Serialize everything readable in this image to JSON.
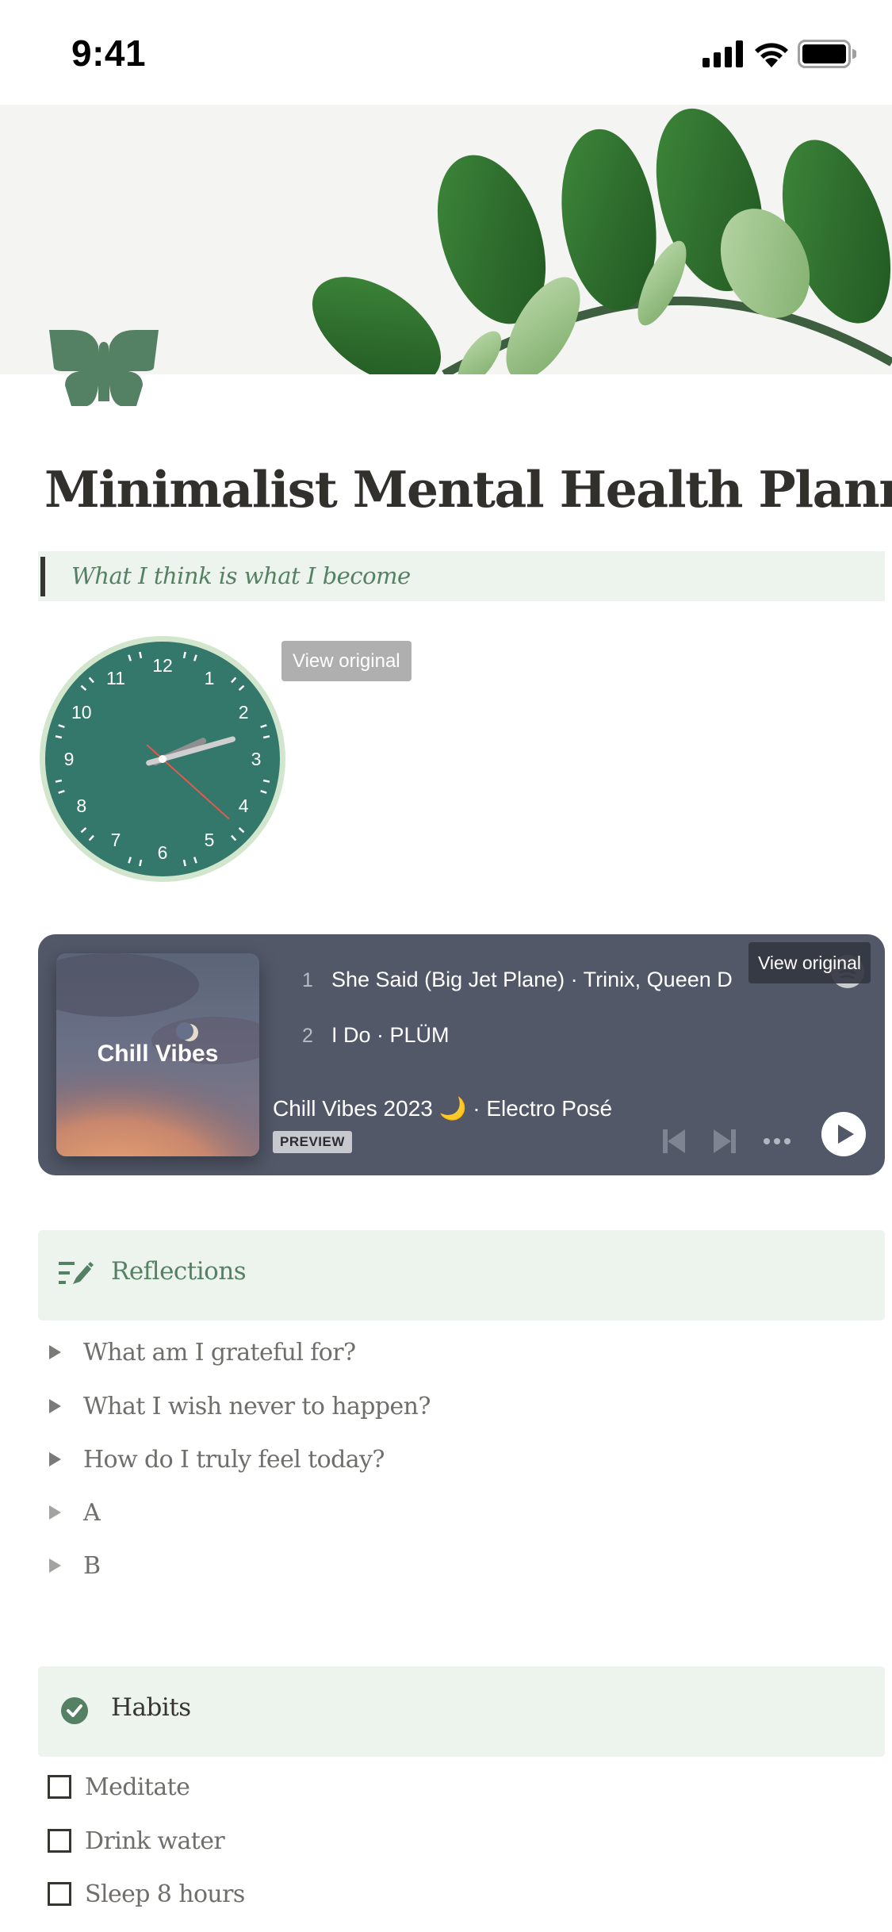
{
  "status_bar": {
    "time": "9:41"
  },
  "page": {
    "title": "Minimalist Mental Health Planner",
    "quote": "What I think is what I become",
    "accent_color": "#548164",
    "callout_bg": "#edf3ed"
  },
  "clock_widget": {
    "view_original_label": "View original",
    "numbers": [
      "12",
      "1",
      "2",
      "3",
      "4",
      "5",
      "6",
      "7",
      "8",
      "9",
      "10",
      "11"
    ],
    "time_shown": {
      "hours": 2,
      "minutes": 12,
      "seconds": 22
    }
  },
  "spotify_embed": {
    "view_original_label": "View original",
    "album_title": "Chill Vibes",
    "tracks": [
      {
        "number": "1",
        "title": "She Said (Big Jet Plane) · Trinix, Queen D"
      },
      {
        "number": "2",
        "title": "I Do · PLÜM"
      }
    ],
    "playlist": "Chill Vibes 2023 🌙 · Electro Posé",
    "badge": "PREVIEW",
    "more_label": "•••"
  },
  "reflections": {
    "heading": "Reflections",
    "items": [
      {
        "label": "What am I grateful for?"
      },
      {
        "label": "What I wish never to happen?"
      },
      {
        "label": "How do I truly feel today?"
      },
      {
        "label": "A"
      },
      {
        "label": "B"
      }
    ]
  },
  "habits": {
    "heading": "Habits",
    "items": [
      {
        "label": "Meditate",
        "checked": false
      },
      {
        "label": "Drink water",
        "checked": false
      },
      {
        "label": "Sleep 8 hours",
        "checked": false
      }
    ]
  }
}
